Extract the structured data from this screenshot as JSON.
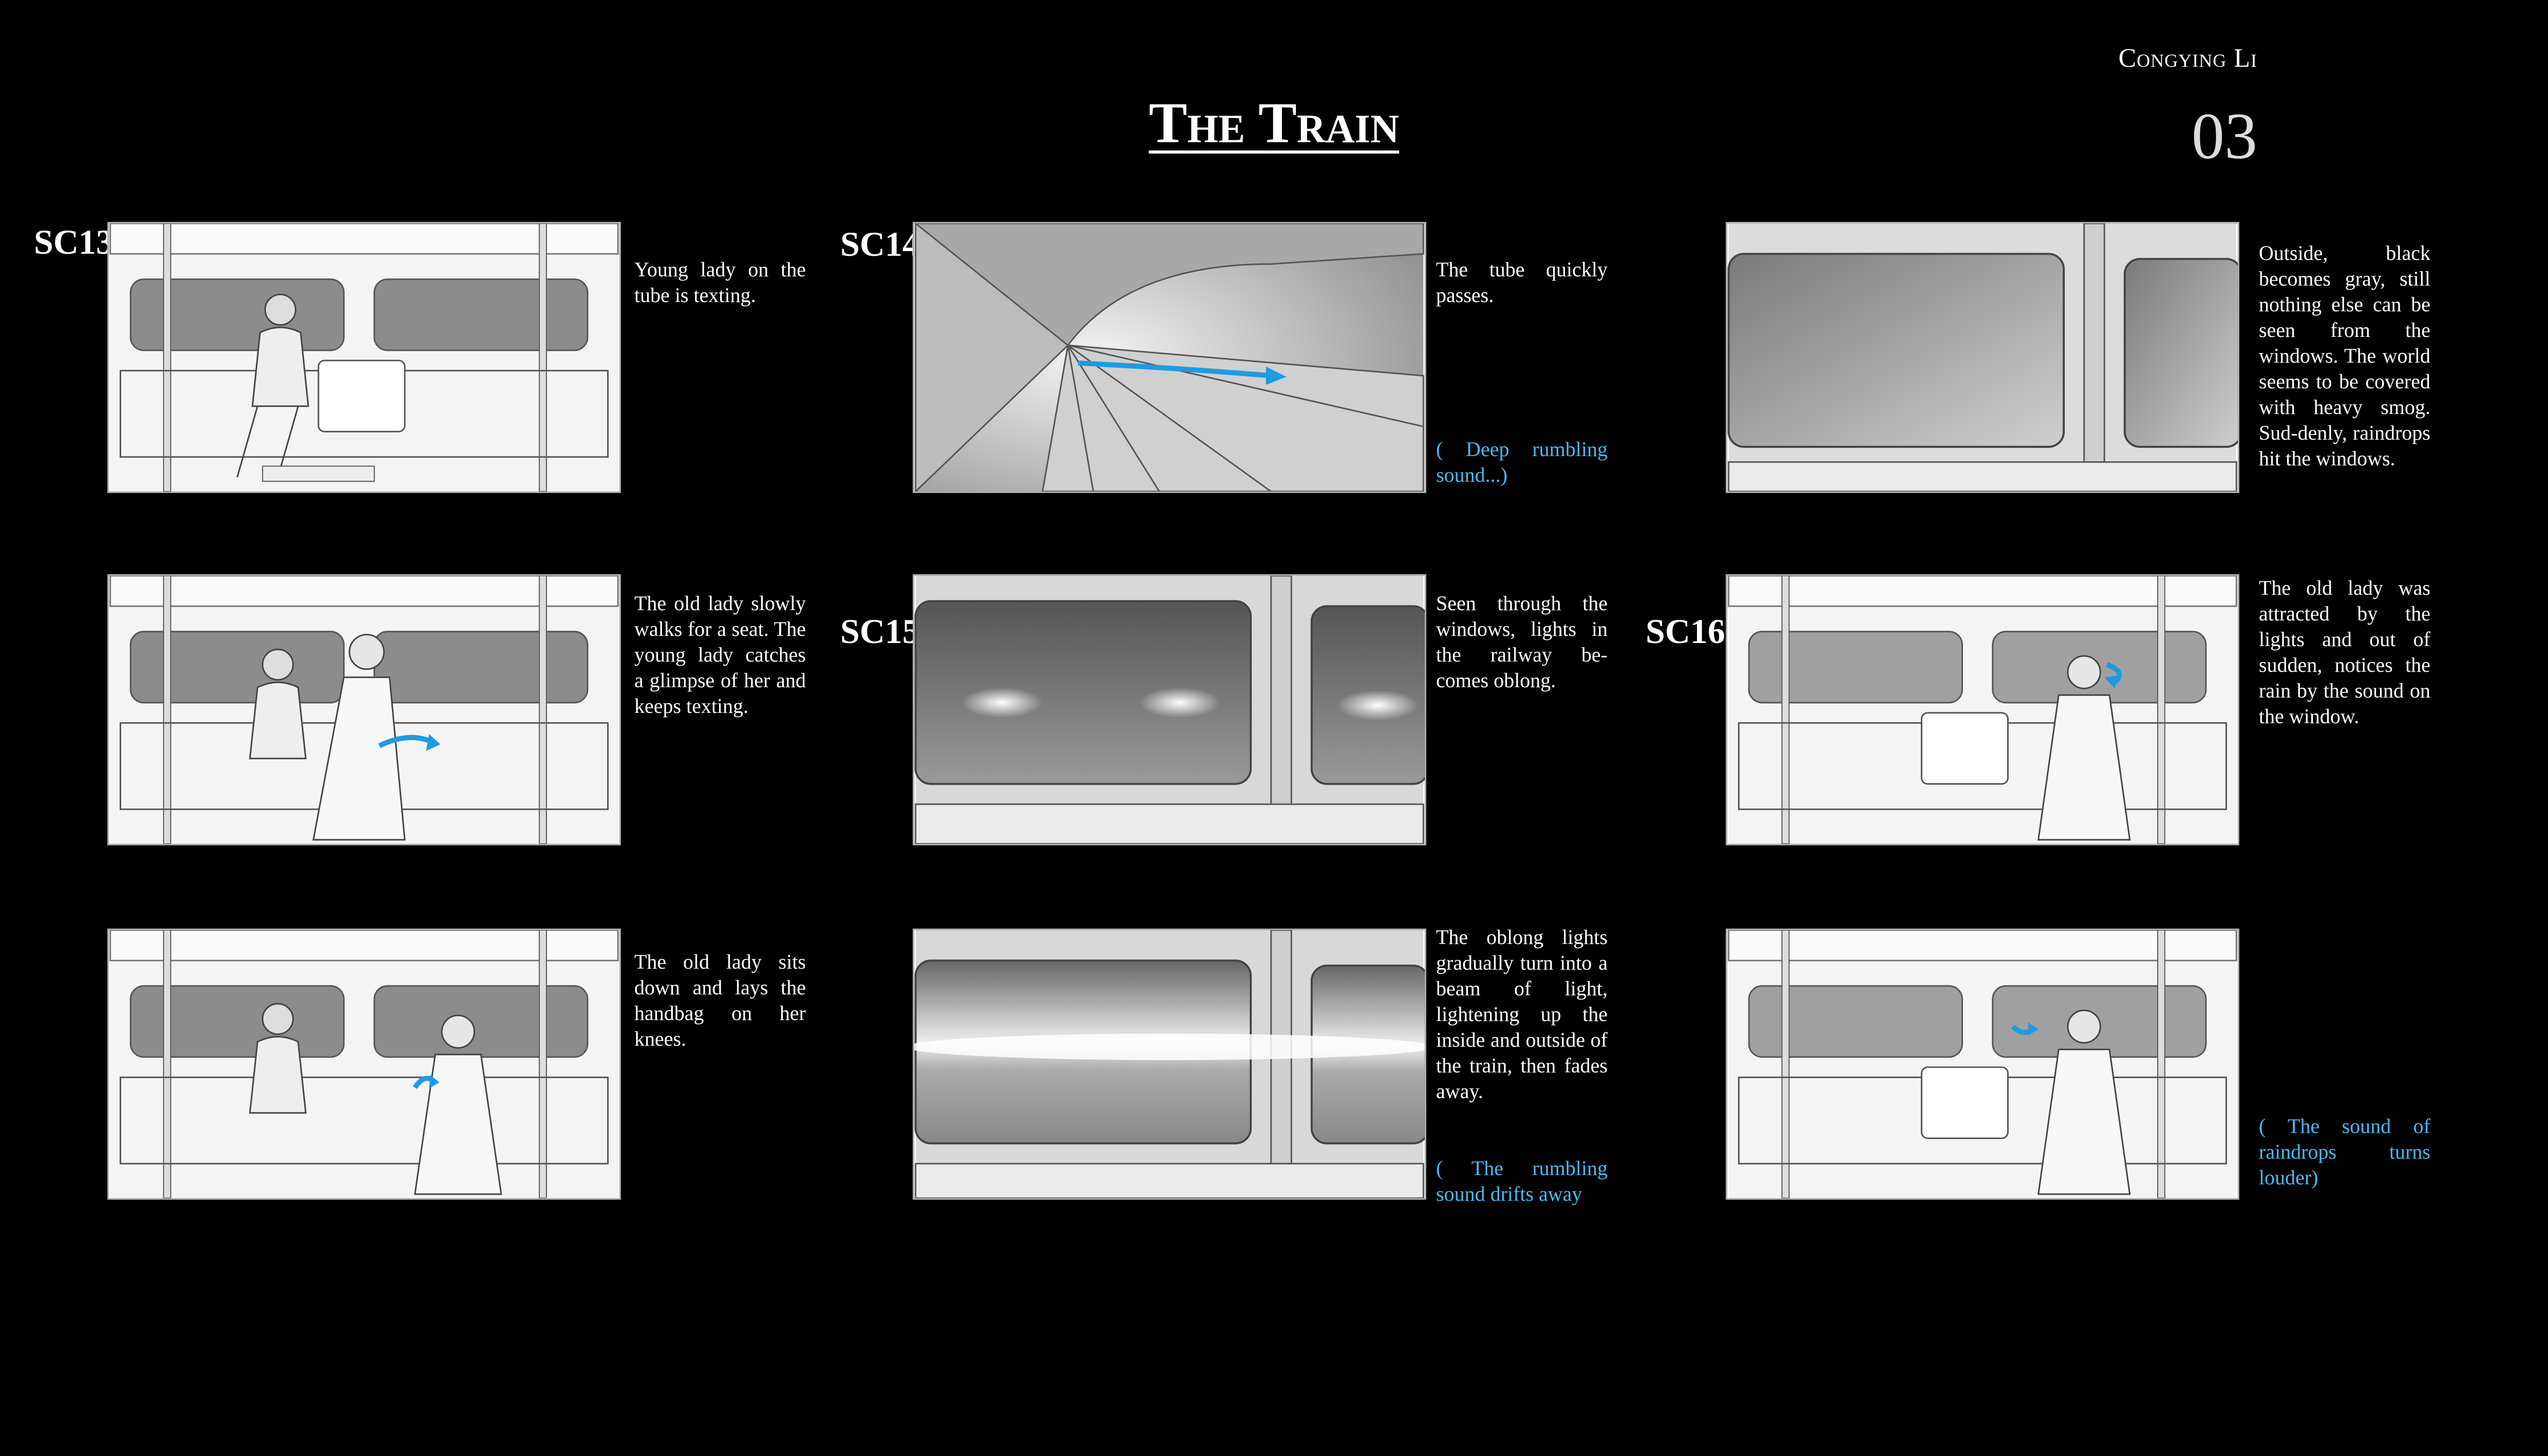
{
  "header": {
    "author": "Congying Li",
    "title": "The Train",
    "page_number": "03"
  },
  "scenes": [
    {
      "label": "SC13"
    },
    {
      "label": "SC14"
    },
    {
      "label": "SC15"
    },
    {
      "label": "SC16"
    }
  ],
  "panels": [
    {
      "caption": "Young lady on the tube is texting."
    },
    {
      "caption": "The old lady slowly walks for a seat. The young lady catches a glimpse of her and keeps texting."
    },
    {
      "caption": "The old lady sits down and lays the handbag on her knees."
    },
    {
      "caption": "The tube quickly passes.",
      "sound": "( Deep rumbling sound...)"
    },
    {
      "caption": "Seen through the windows, lights in the railway be-comes oblong."
    },
    {
      "caption": "The oblong lights gradually turn into a beam of light, lightening up the inside and outside of the train, then fades away.",
      "sound": "( The rumbling sound drifts away"
    },
    {
      "caption": "Outside, black becomes gray, still nothing else can be seen from the windows. The world seems to be covered with heavy smog. Sud-denly, raindrops hit the windows."
    },
    {
      "caption": "The old lady was attracted by the lights and out of sudden, notices the rain by the sound on the window."
    },
    {
      "sound": "( The sound of raindrops turns louder)"
    }
  ],
  "colors": {
    "background": "#000000",
    "text": "#ffffff",
    "sound_note": "#4db8f0",
    "arrow": "#1e9be0"
  }
}
